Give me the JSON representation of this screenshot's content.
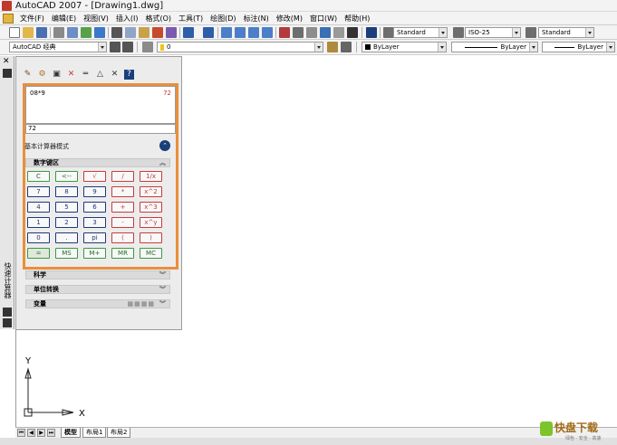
{
  "window": {
    "title": "AutoCAD 2007 - [Drawing1.dwg]"
  },
  "menubar": {
    "items": [
      "文件(F)",
      "编辑(E)",
      "视图(V)",
      "插入(I)",
      "格式(O)",
      "工具(T)",
      "绘图(D)",
      "标注(N)",
      "修改(M)",
      "窗口(W)",
      "帮助(H)"
    ]
  },
  "toolbar": {
    "text_style": "Standard",
    "dim_style": "ISO-25",
    "table_style": "Standard",
    "workspace": "AutoCAD 经典",
    "layer": "0",
    "color": "ByLayer",
    "linetype": "ByLayer",
    "lineweight": "ByLayer"
  },
  "palette": {
    "side_label": "快速计算器"
  },
  "calculator": {
    "history_expr": "08*9",
    "history_result": "72",
    "input_value": "72",
    "mode_label": "基本计算器模式",
    "sections": {
      "numpad": "数字键区",
      "science": "科学",
      "units": "单位转换",
      "variables": "变量"
    },
    "keys": [
      [
        "C",
        "<--",
        "√",
        "/",
        "1/x"
      ],
      [
        "7",
        "8",
        "9",
        "*",
        "x^2"
      ],
      [
        "4",
        "5",
        "6",
        "+",
        "x^3"
      ],
      [
        "1",
        "2",
        "3",
        "-",
        "x^y"
      ],
      [
        "0",
        ".",
        "pi",
        "(",
        ")"
      ],
      [
        "=",
        "MS",
        "M+",
        "MR",
        "MC"
      ]
    ]
  },
  "ucs": {
    "x_label": "X",
    "y_label": "Y"
  },
  "layout_tabs": [
    "模型",
    "布局1",
    "布局2"
  ],
  "watermark": {
    "title": "快盘下载",
    "subtitle": "绿色 · 安全 · 高速"
  },
  "colors": {
    "orange_highlight": "#e98f3b",
    "green_key": "#3b9a40",
    "blue_key": "#1e3a7a",
    "red_key": "#c83c3c"
  }
}
